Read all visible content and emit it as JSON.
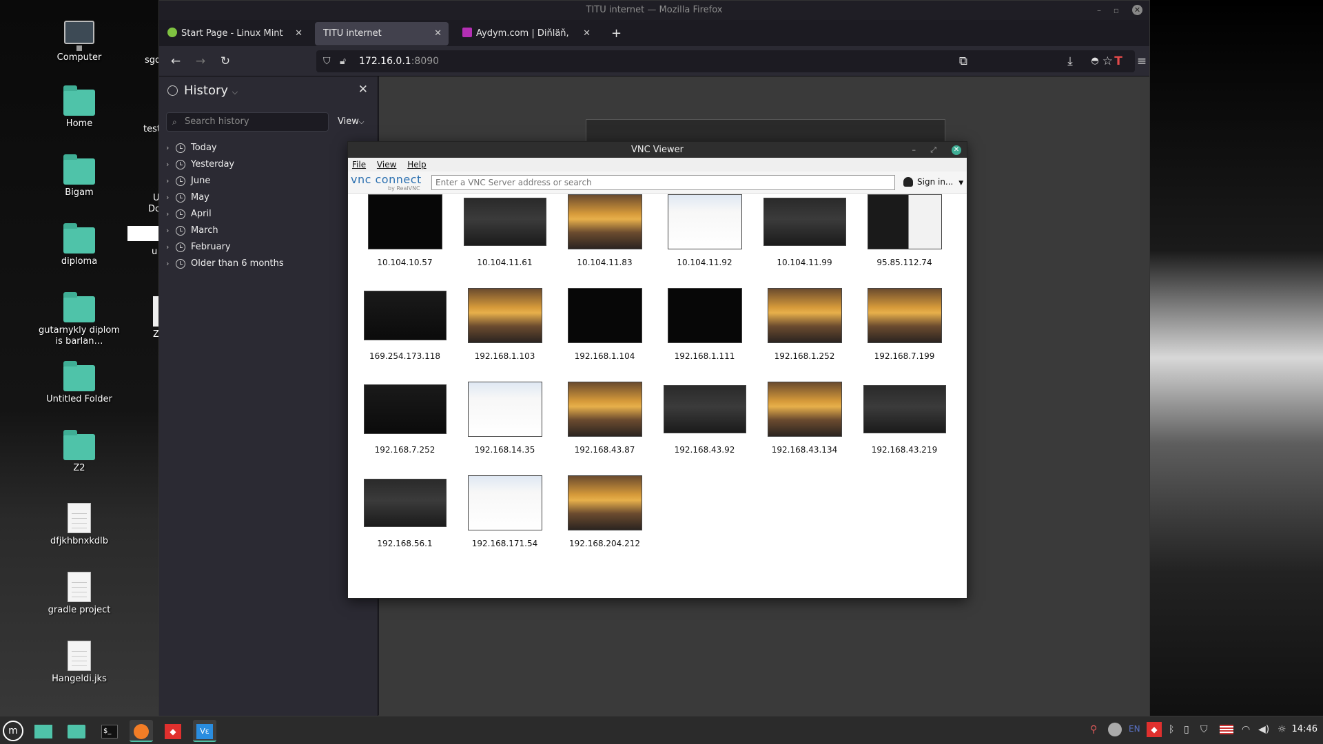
{
  "desktop": {
    "icons": [
      {
        "label": "Computer",
        "kind": "computer"
      },
      {
        "label": "Home",
        "kind": "folder"
      },
      {
        "label": "Bigam",
        "kind": "folder"
      },
      {
        "label": "diploma",
        "kind": "folder"
      },
      {
        "label": "gutarnykly diplom is barlan…",
        "kind": "folder"
      },
      {
        "label": "Untitled Folder",
        "kind": "folder"
      },
      {
        "label": "Z2",
        "kind": "folder"
      },
      {
        "label": "dfjkhbnxkdlb",
        "kind": "document"
      },
      {
        "label": "gradle project",
        "kind": "document"
      },
      {
        "label": "Hangeldi.jks",
        "kind": "document"
      }
    ],
    "partial_labels": [
      "sgd",
      "test",
      "U",
      "Dc",
      "u",
      "Z"
    ]
  },
  "firefox": {
    "window_title": "TITU internet — Mozilla Firefox",
    "tabs": [
      {
        "label": "Start Page - Linux Mint",
        "icon": "mint-icon",
        "active": false
      },
      {
        "label": "TITU internet",
        "icon": "",
        "active": true
      },
      {
        "label": "Aydym.com | Diňläň, lezzet",
        "icon": "aydym-icon",
        "active": false
      }
    ],
    "new_tab": "+",
    "url_host": "172.16.0.1",
    "url_port": ":8090",
    "sidebar": {
      "title": "History",
      "search_placeholder": "Search history",
      "view_label": "View",
      "items": [
        "Today",
        "Yesterday",
        "June",
        "May",
        "April",
        "March",
        "February",
        "Older than 6 months"
      ]
    }
  },
  "vnc": {
    "title": "VNC Viewer",
    "menu": [
      "File",
      "View",
      "Help"
    ],
    "brand": "vnc connect",
    "brand_sub": "by RealVNC",
    "search_placeholder": "Enter a VNC Server address or search",
    "signin": "Sign in...",
    "connections": [
      {
        "ip": "10.104.10.57",
        "style": "black"
      },
      {
        "ip": "10.104.11.61",
        "style": "dark"
      },
      {
        "ip": "10.104.11.83",
        "style": "sunset"
      },
      {
        "ip": "10.104.11.92",
        "style": "web"
      },
      {
        "ip": "10.104.11.99",
        "style": "dark"
      },
      {
        "ip": "95.85.112.74",
        "style": "mixed"
      },
      {
        "ip": "169.254.173.118",
        "style": "term"
      },
      {
        "ip": "192.168.1.103",
        "style": "sunset"
      },
      {
        "ip": "192.168.1.104",
        "style": "black"
      },
      {
        "ip": "192.168.1.111",
        "style": "black"
      },
      {
        "ip": "192.168.1.252",
        "style": "sunset"
      },
      {
        "ip": "192.168.7.199",
        "style": "sunset"
      },
      {
        "ip": "192.168.7.252",
        "style": "term"
      },
      {
        "ip": "192.168.14.35",
        "style": "web"
      },
      {
        "ip": "192.168.43.87",
        "style": "sunset"
      },
      {
        "ip": "192.168.43.92",
        "style": "dark"
      },
      {
        "ip": "192.168.43.134",
        "style": "sunset"
      },
      {
        "ip": "192.168.43.219",
        "style": "dark"
      },
      {
        "ip": "192.168.56.1",
        "style": "dark"
      },
      {
        "ip": "192.168.171.54",
        "style": "web"
      },
      {
        "ip": "192.168.204.212",
        "style": "sunset"
      }
    ]
  },
  "taskbar": {
    "language": "EN",
    "clock": "14:46",
    "accent": "#4fc3a9"
  }
}
